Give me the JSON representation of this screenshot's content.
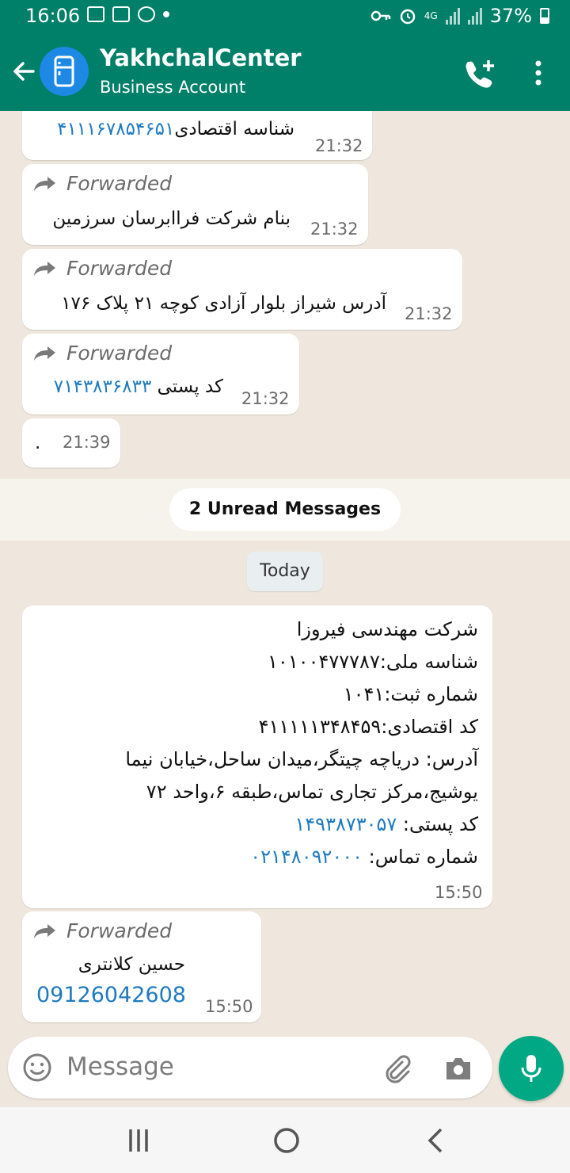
{
  "status_bar": {
    "time": "16:06",
    "network": "4G",
    "battery": "37%"
  },
  "header": {
    "title": "YakhchalCenter",
    "subtitle": "Business Account"
  },
  "messages": [
    {
      "number": "۴۱۱۱۶۷۸۵۴۶۵۱",
      "text": " شناسه اقتصادی",
      "time": "21:32"
    },
    {
      "forwarded_label": "Forwarded",
      "text": "بنام شرکت فراابرسان سرزمین",
      "time": "21:32"
    },
    {
      "forwarded_label": "Forwarded",
      "text": "آدرس شیراز بلوار آزادی کوچه ۲۱ پلاک ۱۷۶",
      "time": "21:32"
    },
    {
      "forwarded_label": "Forwarded",
      "text": "کد پستی ",
      "number": "۷۱۴۳۸۳۶۸۳۳",
      "time": "21:32"
    },
    {
      "text": ".",
      "time": "21:39"
    }
  ],
  "unread_banner": "2 Unread Messages",
  "date_chip": "Today",
  "business_message": {
    "lines": [
      "شرکت مهندسی فیروزا",
      "شناسه ملی:۱۰۱۰۰۴۷۷۷۸۷",
      "شماره ثبت:۱۰۴۱",
      "کد اقتصادی:۴۱۱۱۱۱۳۴۸۴۵۹",
      "آدرس: دریاچه چیتگر،میدان ساحل،خیابان نیما",
      "یوشیج،مرکز تجاری تماس،طبقه ۶،واحد ۷۲"
    ],
    "postal_label": "کد پستی: ",
    "postal_number": "۱۴۹۳۸۷۳۰۵۷",
    "phone_label": "شماره تماس: ",
    "phone_number": "۰۲۱۴۸۰۹۲۰۰۰",
    "time": "15:50"
  },
  "last_message": {
    "forwarded_label": "Forwarded",
    "name": "حسین کلانتری",
    "phone": "09126042608",
    "time": "15:50"
  },
  "composer": {
    "placeholder": "Message"
  },
  "icons": [
    "back-arrow-icon",
    "refrigerator-avatar-icon",
    "add-call-icon",
    "more-vert-icon",
    "forward-icon",
    "emoji-icon",
    "attach-icon",
    "camera-icon",
    "mic-icon"
  ],
  "colors": {
    "header": "#008069",
    "chat_bg": "#efe7dd",
    "link": "#1f7bbf",
    "mic_button": "#00a884"
  }
}
